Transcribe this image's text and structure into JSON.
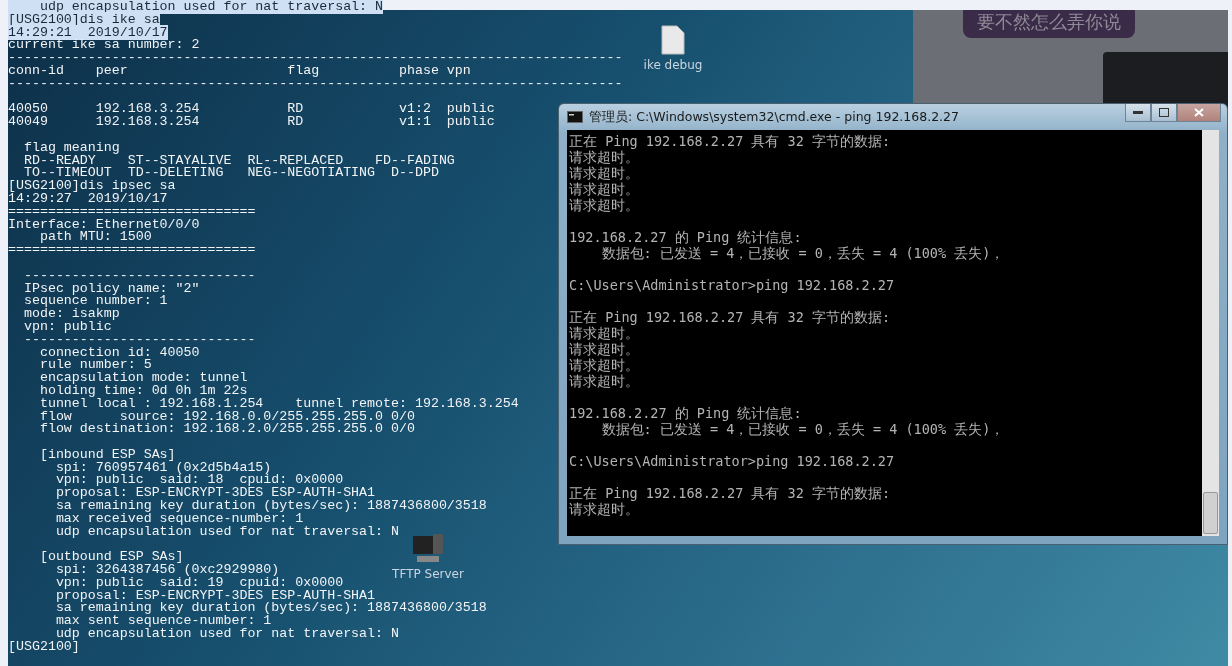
{
  "terminal": {
    "selected_lines": [
      "    udp encapsulation used for nat traversal: N",
      "[USG2100]dis ike sa",
      "14:29:21  2019/10/17"
    ],
    "lines": [
      {
        "kind": "text",
        "text": "current ike sa number: 2"
      },
      {
        "kind": "text",
        "text": "-----------------------------------------------------------------------------"
      },
      {
        "kind": "text",
        "text": "conn-id    peer                    flag          phase vpn"
      },
      {
        "kind": "text",
        "text": "-----------------------------------------------------------------------------"
      },
      {
        "kind": "blank"
      },
      {
        "kind": "text",
        "text": "40050      192.168.3.254           RD            v1:2  public"
      },
      {
        "kind": "text",
        "text": "40049      192.168.3.254           RD            v1:1  public"
      },
      {
        "kind": "blank"
      },
      {
        "kind": "text",
        "text": "  flag meaning"
      },
      {
        "kind": "text",
        "text": "  RD--READY    ST--STAYALIVE  RL--REPLACED    FD--FADING"
      },
      {
        "kind": "text",
        "text": "  TO--TIMEOUT  TD--DELETING   NEG--NEGOTIATING  D--DPD"
      },
      {
        "kind": "text",
        "text": "[USG2100]dis ipsec sa"
      },
      {
        "kind": "text",
        "text": "14:29:27  2019/10/17"
      },
      {
        "kind": "text",
        "text": "==============================="
      },
      {
        "kind": "text",
        "text": "Interface: Ethernet0/0/0"
      },
      {
        "kind": "text",
        "text": "    path MTU: 1500"
      },
      {
        "kind": "text",
        "text": "==============================="
      },
      {
        "kind": "blank"
      },
      {
        "kind": "text",
        "text": "  -----------------------------"
      },
      {
        "kind": "text",
        "text": "  IPsec policy name: \"2\""
      },
      {
        "kind": "text",
        "text": "  sequence number: 1"
      },
      {
        "kind": "text",
        "text": "  mode: isakmp"
      },
      {
        "kind": "text",
        "text": "  vpn: public"
      },
      {
        "kind": "text",
        "text": "  -----------------------------"
      },
      {
        "kind": "text",
        "text": "    connection id: 40050"
      },
      {
        "kind": "text",
        "text": "    rule number: 5"
      },
      {
        "kind": "text",
        "text": "    encapsulation mode: tunnel"
      },
      {
        "kind": "text",
        "text": "    holding time: 0d 0h 1m 22s"
      },
      {
        "kind": "text",
        "text": "    tunnel local : 192.168.1.254    tunnel remote: 192.168.3.254"
      },
      {
        "kind": "text",
        "text": "    flow      source: 192.168.0.0/255.255.255.0 0/0"
      },
      {
        "kind": "text",
        "text": "    flow destination: 192.168.2.0/255.255.255.0 0/0"
      },
      {
        "kind": "blank"
      },
      {
        "kind": "text",
        "text": "    [inbound ESP SAs]"
      },
      {
        "kind": "text",
        "text": "      spi: 760957461 (0x2d5b4a15)"
      },
      {
        "kind": "text",
        "text": "      vpn: public  said: 18  cpuid: 0x0000"
      },
      {
        "kind": "text",
        "text": "      proposal: ESP-ENCRYPT-3DES ESP-AUTH-SHA1"
      },
      {
        "kind": "text",
        "text": "      sa remaining key duration (bytes/sec): 1887436800/3518"
      },
      {
        "kind": "text",
        "text": "      max received sequence-number: 1"
      },
      {
        "kind": "text",
        "text": "      udp encapsulation used for nat traversal: N"
      },
      {
        "kind": "blank"
      },
      {
        "kind": "text",
        "text": "    [outbound ESP SAs]"
      },
      {
        "kind": "text",
        "text": "      spi: 3264387456 (0xc2929980)"
      },
      {
        "kind": "text",
        "text": "      vpn: public  said: 19  cpuid: 0x0000"
      },
      {
        "kind": "text",
        "text": "      proposal: ESP-ENCRYPT-3DES ESP-AUTH-SHA1"
      },
      {
        "kind": "text",
        "text": "      sa remaining key duration (bytes/sec): 1887436800/3518"
      },
      {
        "kind": "text",
        "text": "      max sent sequence-number: 1"
      },
      {
        "kind": "text",
        "text": "      udp encapsulation used for nat traversal: N"
      },
      {
        "kind": "text",
        "text": "[USG2100]"
      }
    ]
  },
  "desktop_icons": [
    {
      "label": "ike debug",
      "kind": "file"
    },
    {
      "label": "TFTP Server",
      "kind": "server"
    }
  ],
  "chat": {
    "message": "要不然怎么弄你说"
  },
  "cmd_window": {
    "title": "管理员: C:\\Windows\\system32\\cmd.exe - ping  192.168.2.27",
    "lines": [
      {
        "kind": "text",
        "text": "正在 Ping 192.168.2.27 具有 32 字节的数据:"
      },
      {
        "kind": "text",
        "text": "请求超时。"
      },
      {
        "kind": "text",
        "text": "请求超时。"
      },
      {
        "kind": "text",
        "text": "请求超时。"
      },
      {
        "kind": "text",
        "text": "请求超时。"
      },
      {
        "kind": "blank"
      },
      {
        "kind": "text",
        "text": "192.168.2.27 的 Ping 统计信息:"
      },
      {
        "kind": "text",
        "text": "    数据包: 已发送 = 4，已接收 = 0，丢失 = 4 (100% 丢失)，"
      },
      {
        "kind": "blank"
      },
      {
        "kind": "text",
        "text": "C:\\Users\\Administrator>ping 192.168.2.27"
      },
      {
        "kind": "blank"
      },
      {
        "kind": "text",
        "text": "正在 Ping 192.168.2.27 具有 32 字节的数据:"
      },
      {
        "kind": "text",
        "text": "请求超时。"
      },
      {
        "kind": "text",
        "text": "请求超时。"
      },
      {
        "kind": "text",
        "text": "请求超时。"
      },
      {
        "kind": "text",
        "text": "请求超时。"
      },
      {
        "kind": "blank"
      },
      {
        "kind": "text",
        "text": "192.168.2.27 的 Ping 统计信息:"
      },
      {
        "kind": "text",
        "text": "    数据包: 已发送 = 4，已接收 = 0，丢失 = 4 (100% 丢失)，"
      },
      {
        "kind": "blank"
      },
      {
        "kind": "text",
        "text": "C:\\Users\\Administrator>ping 192.168.2.27"
      },
      {
        "kind": "blank"
      },
      {
        "kind": "text",
        "text": "正在 Ping 192.168.2.27 具有 32 字节的数据:"
      },
      {
        "kind": "text",
        "text": "请求超时。"
      }
    ]
  }
}
